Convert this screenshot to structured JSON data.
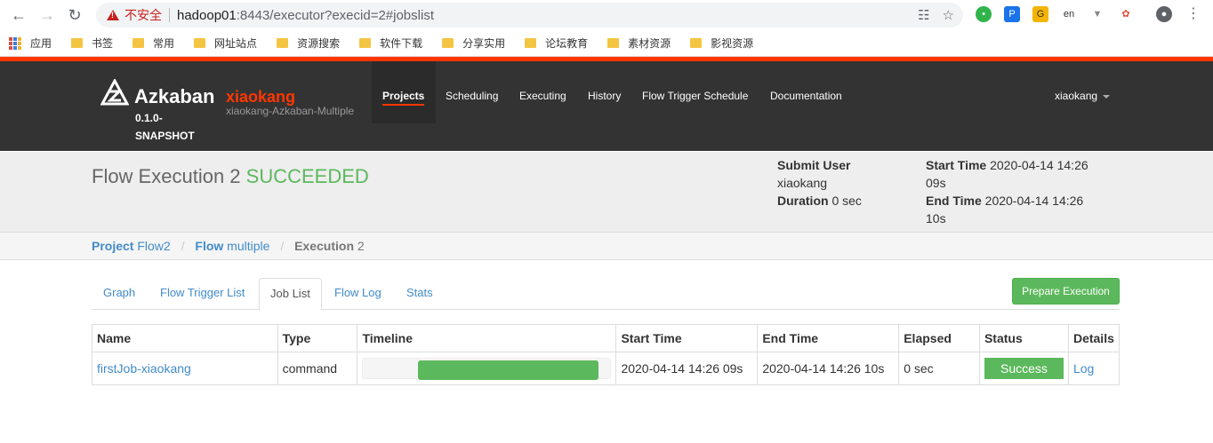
{
  "browser": {
    "insecure_label": "不安全",
    "url_host": "hadoop01",
    "url_rest": ":8443/executor?execid=2#jobslist",
    "bookmarks": [
      "应用",
      "书签",
      "常用",
      "网址站点",
      "资源搜索",
      "软件下载",
      "分享实用",
      "论坛教育",
      "素材资源",
      "影视资源"
    ]
  },
  "navbar": {
    "brand": "Azkaban",
    "version": "0.1.0-SNAPSHOT",
    "instance_name": "xiaokang",
    "instance_sub": "xiaokang-Azkaban-Multiple",
    "items": [
      "Projects",
      "Scheduling",
      "Executing",
      "History",
      "Flow Trigger Schedule",
      "Documentation"
    ],
    "user": "xiaokang"
  },
  "header": {
    "title_prefix": "Flow Execution 2",
    "status": "SUCCEEDED",
    "submit_user_label": "Submit User",
    "submit_user": "xiaokang",
    "duration_label": "Duration",
    "duration": "0 sec",
    "start_label": "Start Time",
    "start_time": "2020-04-14 14:26 09s",
    "end_label": "End Time",
    "end_time": "2020-04-14 14:26 10s",
    "status_color": "#5cb85c"
  },
  "breadcrumb": {
    "project_label": "Project",
    "project": "Flow2",
    "flow_label": "Flow",
    "flow": "multiple",
    "exec_label": "Execution",
    "exec": "2"
  },
  "tabs": [
    "Graph",
    "Flow Trigger List",
    "Job List",
    "Flow Log",
    "Stats"
  ],
  "prepare_button": "Prepare Execution",
  "table": {
    "headers": [
      "Name",
      "Type",
      "Timeline",
      "Start Time",
      "End Time",
      "Elapsed",
      "Status",
      "Details"
    ],
    "rows": [
      {
        "name": "firstJob-xiaokang",
        "type": "command",
        "timeline_start": 0.22,
        "timeline_end": 0.95,
        "start": "2020-04-14 14:26 09s",
        "end": "2020-04-14 14:26 10s",
        "elapsed": "0 sec",
        "status": "Success",
        "details": "Log"
      }
    ]
  }
}
